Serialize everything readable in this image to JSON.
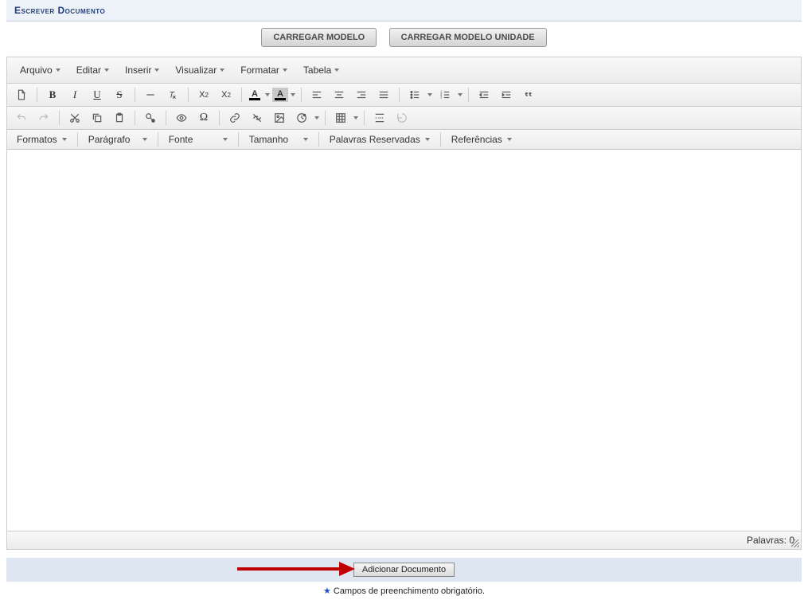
{
  "section_title": "Escrever Documento",
  "model_buttons": {
    "load_model": "CARREGAR MODELO",
    "load_unit_model": "CARREGAR MODELO UNIDADE"
  },
  "menubar": {
    "file": "Arquivo",
    "edit": "Editar",
    "insert": "Inserir",
    "view": "Visualizar",
    "format": "Formatar",
    "table": "Tabela"
  },
  "toolbar3": {
    "formats": "Formatos",
    "paragraph": "Parágrafo",
    "font": "Fonte",
    "size": "Tamanho",
    "reserved_words": "Palavras Reservadas",
    "references": "Referências"
  },
  "status": {
    "words_label": "Palavras:",
    "words_count": "0"
  },
  "footer": {
    "add_document": "Adicionar Documento"
  },
  "required_note": "Campos de preenchimento obrigatório."
}
